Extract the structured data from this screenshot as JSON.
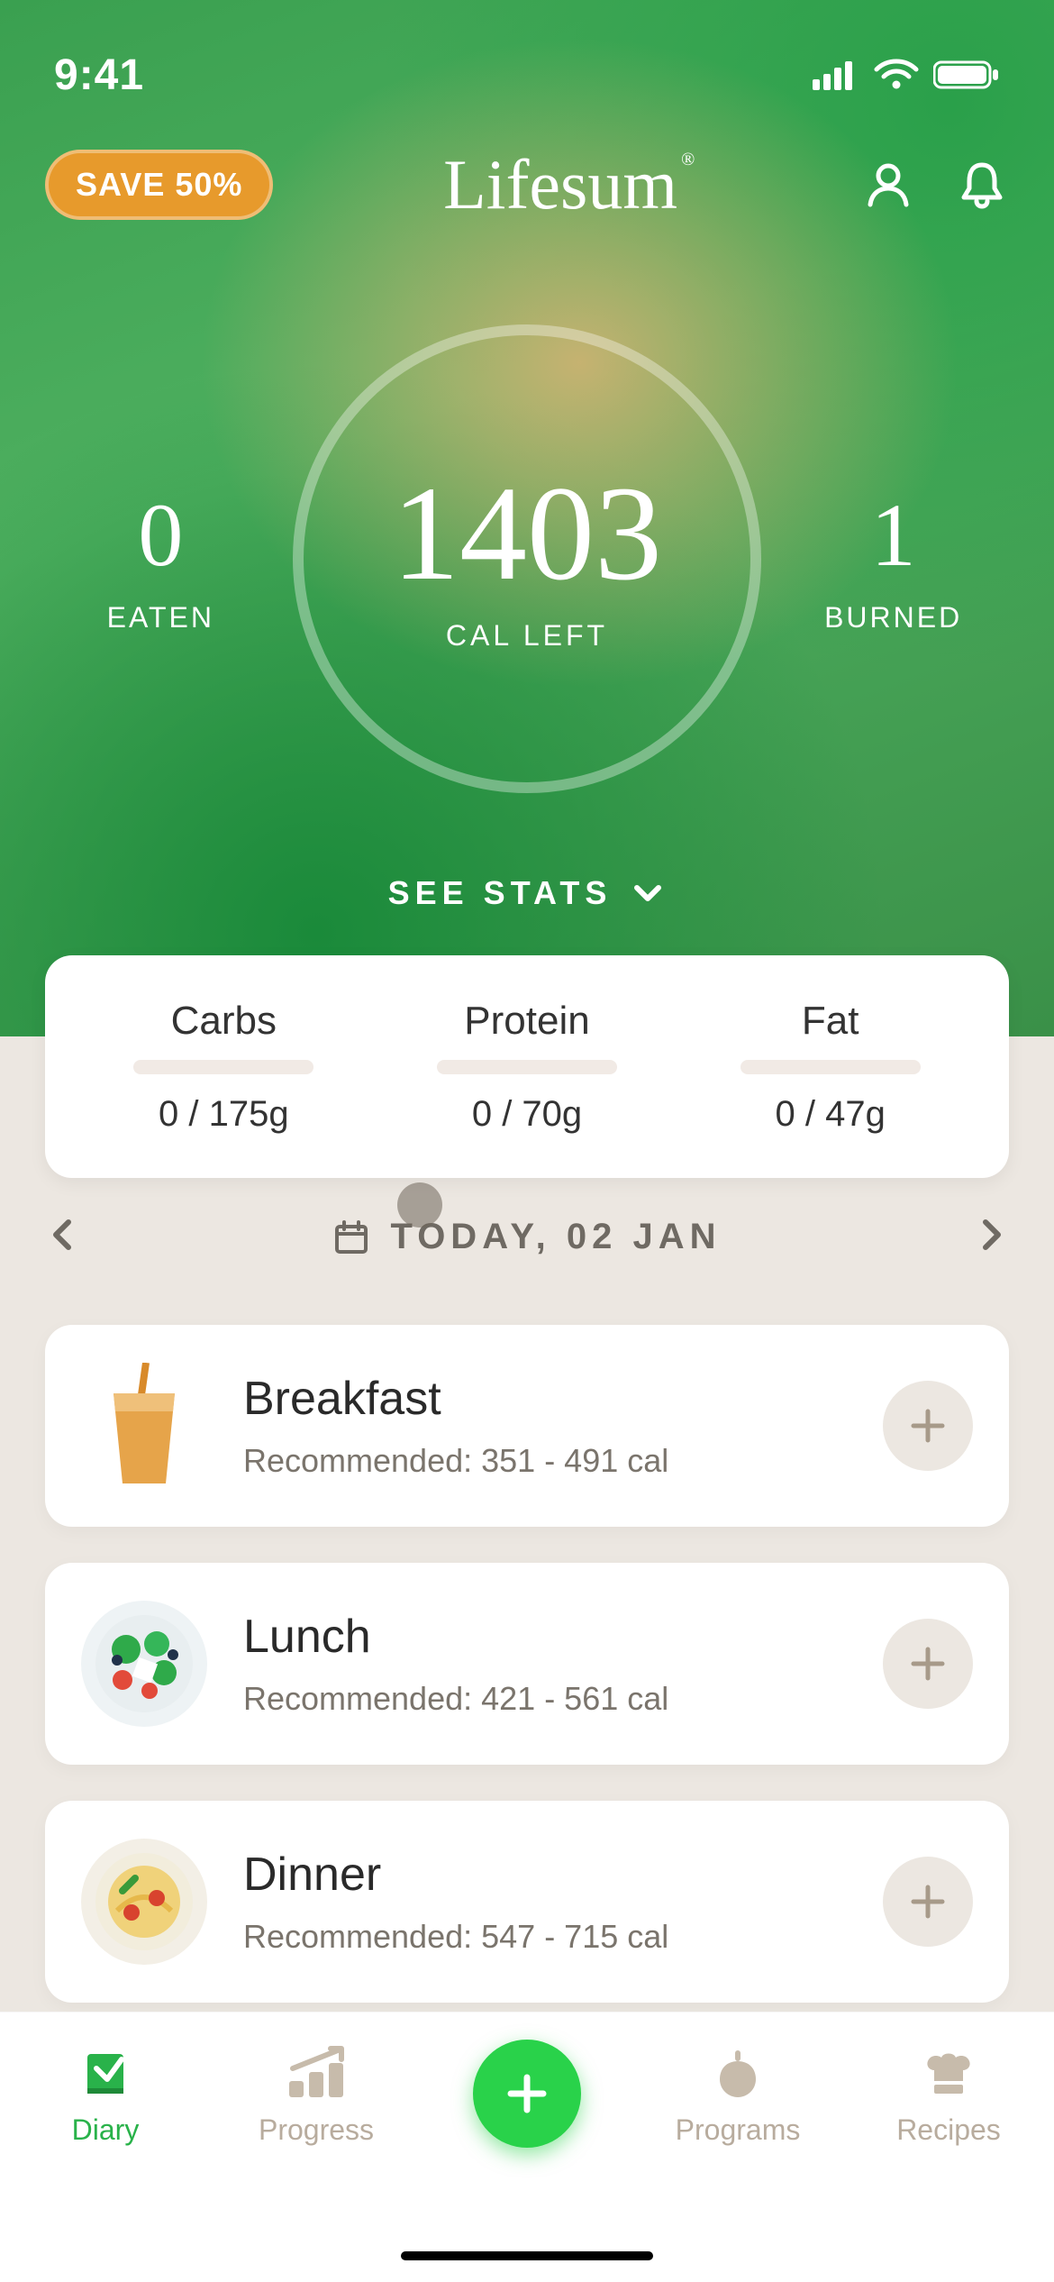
{
  "status": {
    "time": "9:41"
  },
  "header": {
    "promo": "SAVE 50%",
    "brand": "Lifesum"
  },
  "summary": {
    "eaten_value": "0",
    "eaten_label": "EATEN",
    "cal_value": "1403",
    "cal_label": "CAL LEFT",
    "burned_value": "1",
    "burned_label": "BURNED",
    "see_stats": "SEE STATS"
  },
  "macros": [
    {
      "name": "Carbs",
      "value": "0 / 175g"
    },
    {
      "name": "Protein",
      "value": "0 / 70g"
    },
    {
      "name": "Fat",
      "value": "0 / 47g"
    }
  ],
  "date": {
    "label": "TODAY, 02 JAN"
  },
  "meals": [
    {
      "title": "Breakfast",
      "sub": "Recommended: 351 - 491  cal"
    },
    {
      "title": "Lunch",
      "sub": "Recommended: 421 - 561  cal"
    },
    {
      "title": "Dinner",
      "sub": "Recommended: 547 - 715  cal"
    }
  ],
  "tabs": {
    "diary": "Diary",
    "progress": "Progress",
    "programs": "Programs",
    "recipes": "Recipes"
  }
}
